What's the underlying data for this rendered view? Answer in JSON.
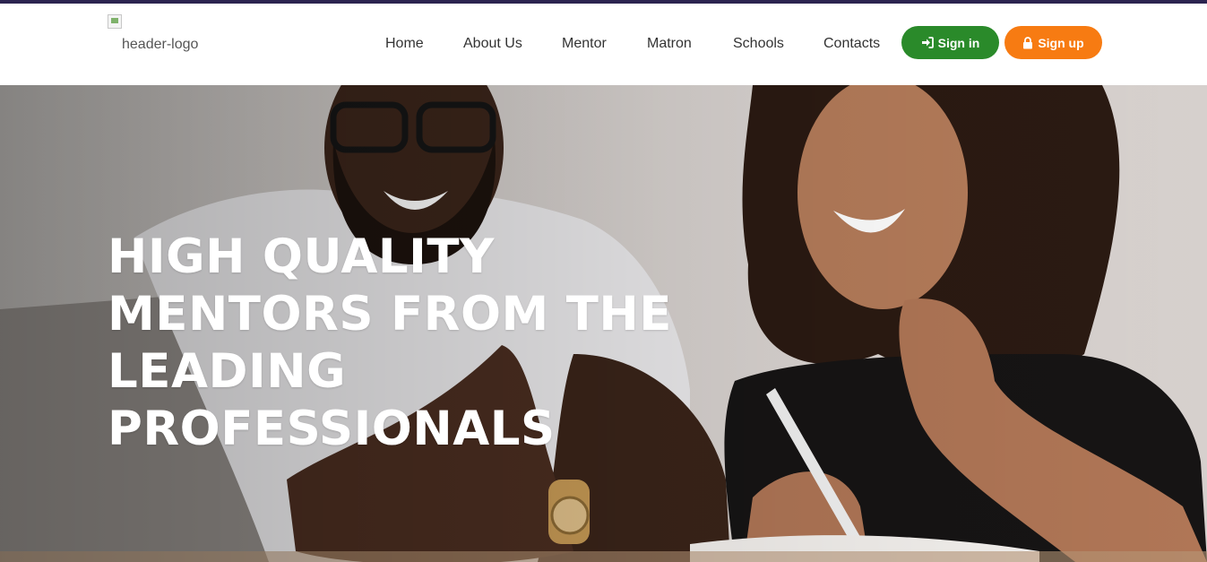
{
  "header": {
    "logo_alt": "header-logo",
    "nav": [
      "Home",
      "About Us",
      "Mentor",
      "Matron",
      "Schools",
      "Contacts"
    ],
    "signin_label": "Sign in",
    "signup_label": "Sign up"
  },
  "hero": {
    "title_lines": [
      "HIGH QUALITY",
      "MENTORS FROM THE",
      "LEADING",
      "PROFESSIONALS"
    ]
  },
  "colors": {
    "top_strip": "#2c2450",
    "signin": "#2a8a2a",
    "signup": "#f77b12"
  }
}
